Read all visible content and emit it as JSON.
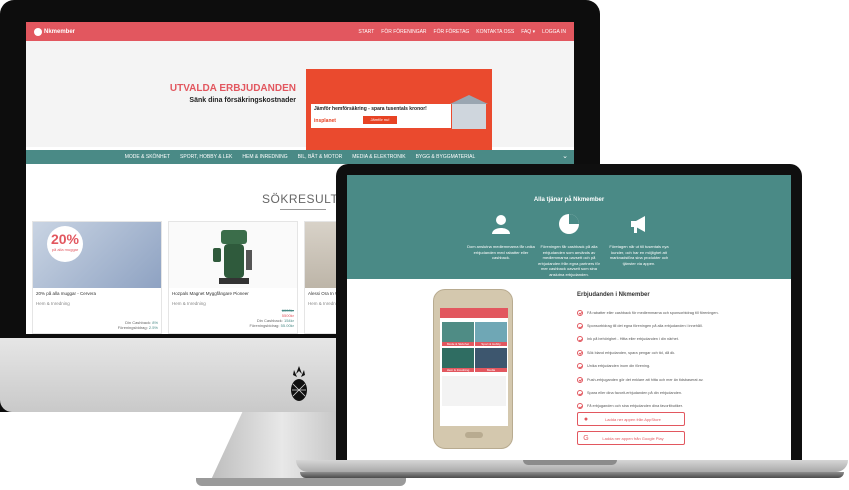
{
  "desktop": {
    "brand": "Nkmember",
    "nav": [
      "START",
      "FÖR FÖRENINGAR",
      "FÖR FÖRETAG",
      "KONTAKTA OSS",
      "FAQ ▾",
      "LOGGA IN"
    ],
    "hero_title": "UTVALDA ERBJUDANDEN",
    "hero_subtitle": "Sänk dina försäkringskostnader",
    "banner": {
      "text": "Jämför hemförsäkring - spara tusentals kronor!",
      "brand": "insplanet",
      "button": "Jämför nu!"
    },
    "categories": [
      "MODE & SKÖNHET",
      "SPORT, HOBBY & LEK",
      "HEM & INREDNING",
      "BIL, BÅT & MOTOR",
      "MEDIA & ELEKTRONIK",
      "BYGG & BYGGMATERIAL"
    ],
    "search_title": "SÖKRESULTAT",
    "products": [
      {
        "badge_pct": "20%",
        "badge_sub": "på alla muggar",
        "title": "20% på alla muggar - Cervera",
        "category": "Hem & Inredning",
        "old_price": "",
        "price": "",
        "cashback_label": "Din Cashback:",
        "cashback": "8%",
        "assoc_label": "Föreningsbidrag:",
        "assoc": "2.5%"
      },
      {
        "badge_pct": "",
        "badge_sub": "",
        "title": "Hozpals Magnet Myggfångare Pioneer",
        "category": "Hem & Inredning",
        "old_price": "6000kr",
        "price": "5500kr",
        "cashback_label": "Din Cashback:",
        "cashback": "154kr",
        "assoc_label": "Föreningsbidrag:",
        "assoc": "55.00kr"
      },
      {
        "badge_pct": "",
        "badge_sub": "",
        "title": "Alessi Ora In Wermeige",
        "category": "Hem & Inredning",
        "old_price": "",
        "price": "",
        "cashback_label": "",
        "cashback": "",
        "assoc_label": "",
        "assoc": ""
      }
    ]
  },
  "laptop": {
    "hero_title": "Alla tjänar på Nkmember",
    "features": [
      {
        "icon": "user-icon",
        "text": "Dom anslutna medlemmarna får unika erbjudanden med rabatter eller cashback."
      },
      {
        "icon": "pie-chart-icon",
        "text": "Föreningen får cashback på alla erbjudanden som används av medlemmarna oavsett och på erbjudanden från egna partners för mer cashback oavsett som sina anslutna erbjudanden."
      },
      {
        "icon": "megaphone-icon",
        "text": "Företagen når ut till tusentals nya kunder, och har en möjlighet att marknadsföra sina produkter och tjänster via appen."
      }
    ],
    "phone_tiles": [
      "Mode & Skönhet",
      "Sport & Hobby",
      "Hem & Inredning",
      "Media"
    ],
    "heading": "Erbjudanden i Nkmember",
    "list": [
      "Få rabatter eller cashback för medlemmarna och sponsorbidrag till föreningen.",
      "Sponsorbidrag till det egna föreningen på alla erbjudanden i innehåll.",
      "Ink på behörighet - Hitta eller erbjudanden i din närhet.",
      "Sök bland erbjudanden, spara pengar och tid, då dk.",
      "Unika erbjudanden inom din förening.",
      "Push-erbjuganden gör det enklare att hitta och mer än tidsbaserat av.",
      "Spara eller dina favorit-erbjudanden på din erbjudanden.",
      "Få erbjuganden och sina erbjudanden dina favoritbutiker."
    ],
    "store_buttons": [
      {
        "icon": "apple-icon",
        "label": "Ladda ner appen från AppStore"
      },
      {
        "icon": "google-play-icon",
        "label": "Ladda ner appen från Google Play"
      }
    ]
  }
}
